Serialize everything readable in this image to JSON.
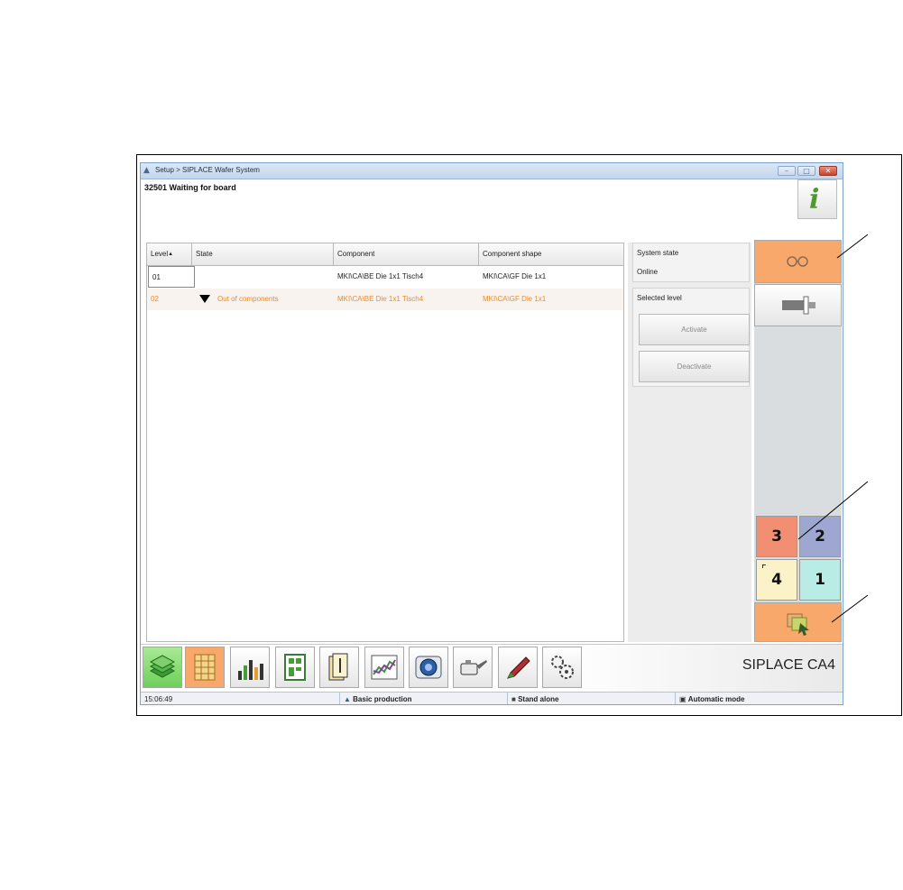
{
  "window": {
    "title": "Setup > SIPLACE Wafer System",
    "message": "32501 Waiting for board",
    "controls": [
      "minimize-icon",
      "maximize-icon",
      "close-icon"
    ]
  },
  "info_button": {
    "glyph": "i",
    "icon": "info-icon"
  },
  "grid": {
    "columns": [
      "Level",
      "State",
      "Component",
      "Component shape"
    ],
    "rows": [
      {
        "level": "01",
        "state": "",
        "component": "MKI\\CA\\BE Die 1x1 Tisch4",
        "shape": "MKI\\CA\\GF Die 1x1"
      },
      {
        "level": "02",
        "state": "Out of components",
        "component": "MKI\\CA\\BE Die 1x1 Tisch4",
        "shape": "MKI\\CA\\GF Die 1x1"
      }
    ]
  },
  "side_panel": {
    "system_state_label": "System state",
    "system_state_value": "Online",
    "selected_level_label": "Selected level",
    "activate_label": "Activate",
    "deactivate_label": "Deactivate"
  },
  "level_buttons": {
    "top_left": "3",
    "top_right": "2",
    "bottom_left": "4",
    "bottom_right": "1"
  },
  "toolbar": {
    "tools": [
      "stack-icon",
      "grid-icon",
      "bar-chart-icon",
      "board-icon",
      "cassette-icon",
      "line-chart-icon",
      "camera-icon",
      "oil-can-icon",
      "pen-icon",
      "gears-icon"
    ],
    "brand": "SIPLACE CA4"
  },
  "statusbar": {
    "time": "15:06:49",
    "production": "Basic production",
    "line_mode": "Stand alone",
    "mode": "Automatic mode"
  },
  "colors": {
    "accent_orange": "#f7a86a",
    "orange_text": "#ef8a2a",
    "green": "#7fd06c"
  }
}
